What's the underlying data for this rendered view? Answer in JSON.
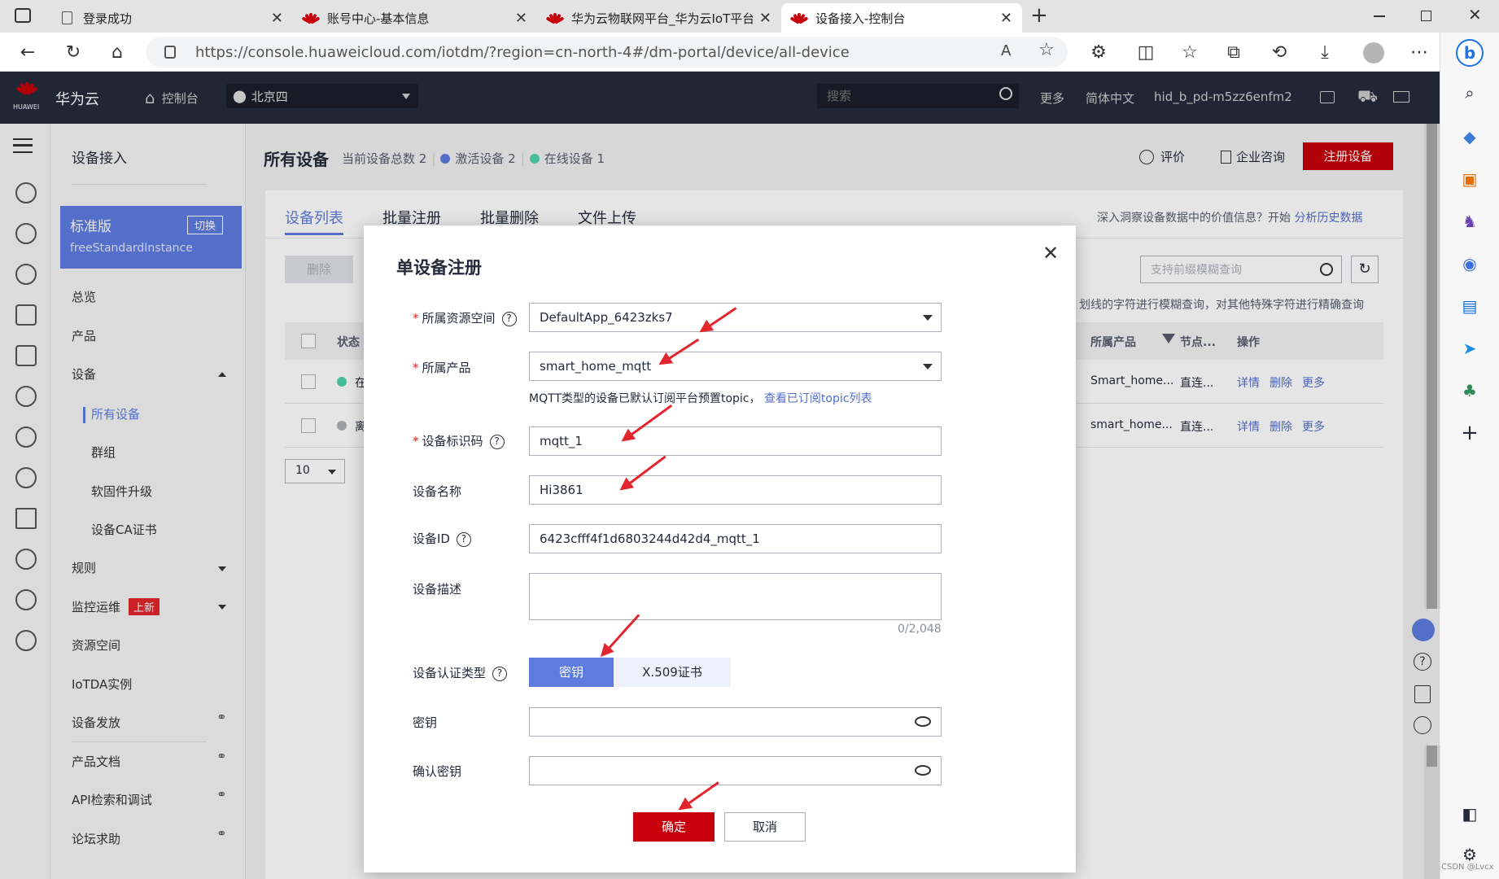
{
  "browser": {
    "tabs": [
      {
        "title": "登录成功",
        "icon": "page-icon"
      },
      {
        "title": "账号中心-基本信息",
        "icon": "huawei-logo-icon"
      },
      {
        "title": "华为云物联网平台_华为云IoT平台",
        "icon": "huawei-logo-icon"
      },
      {
        "title": "设备接入-控制台",
        "icon": "huawei-logo-icon",
        "active": true
      }
    ],
    "url": "https://console.huaweicloud.com/iotdm/?region=cn-north-4#/dm-portal/device/all-device"
  },
  "header": {
    "brand": "华为云",
    "brand_small": "HUAWEI",
    "console": "控制台",
    "region": "北京四",
    "search_placeholder": "搜索",
    "more": "更多",
    "language": "简体中文",
    "user": "hid_b_pd-m5zz6enfm2"
  },
  "sidenav": {
    "title": "设备接入",
    "instance_edition": "标准版",
    "instance_switch": "切换",
    "instance_name": "freeStandardInstance",
    "items": [
      "总览",
      "产品",
      "设备",
      "所有设备",
      "群组",
      "软固件升级",
      "设备CA证书",
      "规则",
      "监控运维",
      "资源空间",
      "IoTDA实例",
      "设备发放",
      "产品文档",
      "API检索和调试",
      "论坛求助"
    ],
    "new_badge": "上新"
  },
  "page": {
    "title": "所有设备",
    "stats_total": "当前设备总数 2",
    "stats_active": "激活设备 2",
    "stats_online": "在线设备 1",
    "feedback": "评价",
    "consult": "企业咨询",
    "register_btn": "注册设备",
    "tabs": [
      "设备列表",
      "批量注册",
      "批量删除",
      "文件上传"
    ],
    "insight_text": "深入洞察设备数据中的价值信息？开始",
    "insight_link": "分析历史数据",
    "delete_btn": "删除",
    "search_placeholder": "支持前缀模糊查询",
    "hint_text": "划线的字符进行模糊查询，对其他特殊字符进行精确查询",
    "columns": [
      "状态",
      "所属产品",
      "节点...",
      "操作"
    ],
    "rows": [
      {
        "status": "在",
        "product": "Smart_home...",
        "node": "直连...",
        "actions": [
          "详情",
          "删除",
          "更多"
        ]
      },
      {
        "status": "离",
        "product": "smart_home...",
        "node": "直连...",
        "actions": [
          "详情",
          "删除",
          "更多"
        ]
      }
    ],
    "page_size": "10"
  },
  "dialog": {
    "title": "单设备注册",
    "labels": {
      "resource_space": "所属资源空间",
      "product": "所属产品",
      "node_id": "设备标识码",
      "device_name": "设备名称",
      "device_id": "设备ID",
      "description": "设备描述",
      "auth_type": "设备认证类型",
      "secret": "密钥",
      "confirm_secret": "确认密钥"
    },
    "values": {
      "resource_space": "DefaultApp_6423zks7",
      "product": "smart_home_mqtt",
      "node_id": "mqtt_1",
      "device_name": "Hi3861",
      "device_id": "6423cfff4f1d6803244d42d4_mqtt_1"
    },
    "mqtt_hint": "MQTT类型的设备已默认订阅平台预置topic，",
    "mqtt_link": "查看已订阅topic列表",
    "desc_counter": "0/2,048",
    "auth_options": [
      "密钥",
      "X.509证书"
    ],
    "confirm_btn": "确定",
    "cancel_btn": "取消"
  },
  "watermark": "CSDN @Lvcx"
}
